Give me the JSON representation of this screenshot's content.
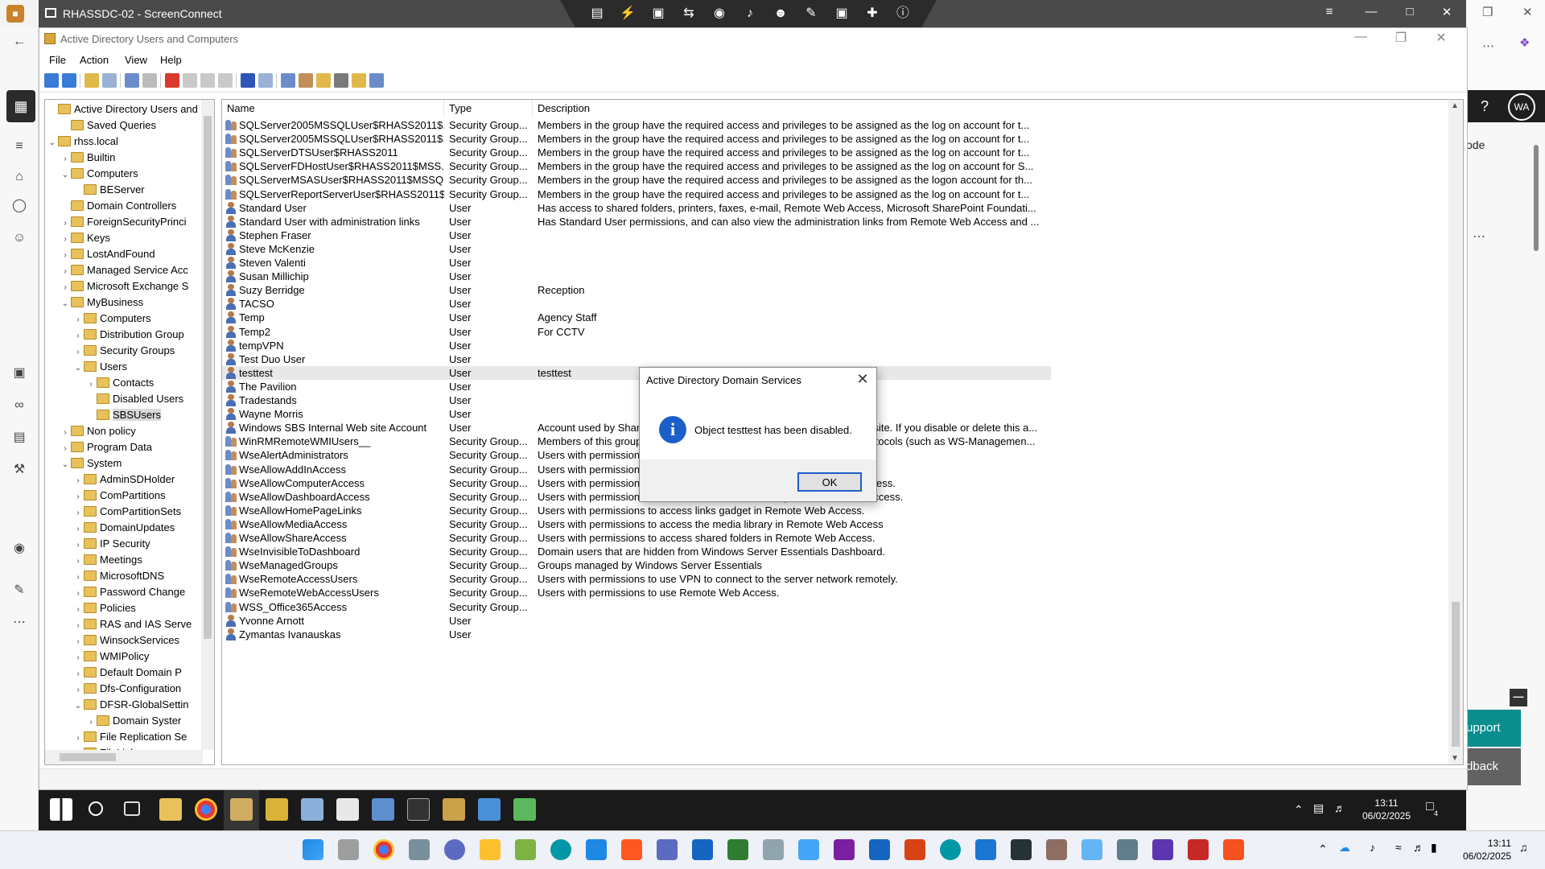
{
  "session": {
    "title": "RHASSDC-02 - ScreenConnect"
  },
  "host_right": {
    "avatar": "WA",
    "partial_text": "ode",
    "support_label": "upport",
    "feedback_label": "dback"
  },
  "aduc": {
    "title": "Active Directory Users and Computers",
    "menu": [
      "File",
      "Action",
      "View",
      "Help"
    ]
  },
  "tree": [
    {
      "label": "Active Directory Users and Co",
      "level": 0,
      "exp": "",
      "sel": false
    },
    {
      "label": "Saved Queries",
      "level": 1,
      "exp": "",
      "sel": false
    },
    {
      "label": "rhss.local",
      "level": 0,
      "exp": "v",
      "sel": false
    },
    {
      "label": "Builtin",
      "level": 1,
      "exp": ">",
      "sel": false
    },
    {
      "label": "Computers",
      "level": 1,
      "exp": "v",
      "sel": false
    },
    {
      "label": "BEServer",
      "level": 2,
      "exp": "",
      "sel": false
    },
    {
      "label": "Domain Controllers",
      "level": 1,
      "exp": "",
      "sel": false
    },
    {
      "label": "ForeignSecurityPrinci",
      "level": 1,
      "exp": ">",
      "sel": false
    },
    {
      "label": "Keys",
      "level": 1,
      "exp": ">",
      "sel": false
    },
    {
      "label": "LostAndFound",
      "level": 1,
      "exp": ">",
      "sel": false
    },
    {
      "label": "Managed Service Acc",
      "level": 1,
      "exp": ">",
      "sel": false
    },
    {
      "label": "Microsoft Exchange S",
      "level": 1,
      "exp": ">",
      "sel": false
    },
    {
      "label": "MyBusiness",
      "level": 1,
      "exp": "v",
      "sel": false
    },
    {
      "label": "Computers",
      "level": 2,
      "exp": ">",
      "sel": false
    },
    {
      "label": "Distribution Group",
      "level": 2,
      "exp": ">",
      "sel": false
    },
    {
      "label": "Security Groups",
      "level": 2,
      "exp": ">",
      "sel": false
    },
    {
      "label": "Users",
      "level": 2,
      "exp": "v",
      "sel": false
    },
    {
      "label": "Contacts",
      "level": 3,
      "exp": ">",
      "sel": false
    },
    {
      "label": "Disabled Users",
      "level": 3,
      "exp": "",
      "sel": false
    },
    {
      "label": "SBSUsers",
      "level": 3,
      "exp": "",
      "sel": true
    },
    {
      "label": "Non policy",
      "level": 1,
      "exp": ">",
      "sel": false
    },
    {
      "label": "Program Data",
      "level": 1,
      "exp": ">",
      "sel": false
    },
    {
      "label": "System",
      "level": 1,
      "exp": "v",
      "sel": false
    },
    {
      "label": "AdminSDHolder",
      "level": 2,
      "exp": ">",
      "sel": false
    },
    {
      "label": "ComPartitions",
      "level": 2,
      "exp": ">",
      "sel": false
    },
    {
      "label": "ComPartitionSets",
      "level": 2,
      "exp": ">",
      "sel": false
    },
    {
      "label": "DomainUpdates",
      "level": 2,
      "exp": ">",
      "sel": false
    },
    {
      "label": "IP Security",
      "level": 2,
      "exp": ">",
      "sel": false
    },
    {
      "label": "Meetings",
      "level": 2,
      "exp": ">",
      "sel": false
    },
    {
      "label": "MicrosoftDNS",
      "level": 2,
      "exp": ">",
      "sel": false
    },
    {
      "label": "Password Change",
      "level": 2,
      "exp": ">",
      "sel": false
    },
    {
      "label": "Policies",
      "level": 2,
      "exp": ">",
      "sel": false
    },
    {
      "label": "RAS and IAS Serve",
      "level": 2,
      "exp": ">",
      "sel": false
    },
    {
      "label": "WinsockServices",
      "level": 2,
      "exp": ">",
      "sel": false
    },
    {
      "label": "WMIPolicy",
      "level": 2,
      "exp": ">",
      "sel": false
    },
    {
      "label": "Default Domain P",
      "level": 2,
      "exp": ">",
      "sel": false
    },
    {
      "label": "Dfs-Configuration",
      "level": 2,
      "exp": ">",
      "sel": false
    },
    {
      "label": "DFSR-GlobalSettin",
      "level": 2,
      "exp": "v",
      "sel": false
    },
    {
      "label": "Domain Syster",
      "level": 3,
      "exp": ">",
      "sel": false
    },
    {
      "label": "File Replication Se",
      "level": 2,
      "exp": ">",
      "sel": false
    },
    {
      "label": "FileLinks",
      "level": 2,
      "exp": ">",
      "sel": false
    }
  ],
  "list": {
    "headers": [
      "Name",
      "Type",
      "Description"
    ],
    "rows": [
      {
        "name": "SQLServer2005MSSQLUser$RHASS2011$...",
        "type": "Security Group...",
        "desc": "Members in the group have the required access and privileges to be assigned as the log on account for t...",
        "kind": "group"
      },
      {
        "name": "SQLServer2005MSSQLUser$RHASS2011$...",
        "type": "Security Group...",
        "desc": "Members in the group have the required access and privileges to be assigned as the log on account for t...",
        "kind": "group"
      },
      {
        "name": "SQLServerDTSUser$RHASS2011",
        "type": "Security Group...",
        "desc": "Members in the group have the required access and privileges to be assigned as the log on account for t...",
        "kind": "group"
      },
      {
        "name": "SQLServerFDHostUser$RHASS2011$MSS...",
        "type": "Security Group...",
        "desc": "Members in the group have the required access and privileges to be assigned as the log on account for S...",
        "kind": "group"
      },
      {
        "name": "SQLServerMSASUser$RHASS2011$MSSQ...",
        "type": "Security Group...",
        "desc": "Members in the group have the required access and privileges to be assigned as the logon account for th...",
        "kind": "group"
      },
      {
        "name": "SQLServerReportServerUser$RHASS2011$...",
        "type": "Security Group...",
        "desc": "Members in the group have the required access and privileges to be assigned as the log on account for t...",
        "kind": "group"
      },
      {
        "name": "Standard User",
        "type": "User",
        "desc": "Has access to shared folders, printers, faxes, e-mail, Remote Web Access, Microsoft SharePoint Foundati...",
        "kind": "user"
      },
      {
        "name": "Standard User with administration links",
        "type": "User",
        "desc": "Has Standard User permissions, and can also view the administration links from Remote Web Access and ...",
        "kind": "user"
      },
      {
        "name": "Stephen Fraser",
        "type": "User",
        "desc": "",
        "kind": "user"
      },
      {
        "name": "Steve McKenzie",
        "type": "User",
        "desc": "",
        "kind": "user"
      },
      {
        "name": "Steven Valenti",
        "type": "User",
        "desc": "",
        "kind": "user"
      },
      {
        "name": "Susan Millichip",
        "type": "User",
        "desc": "",
        "kind": "user"
      },
      {
        "name": "Suzy Berridge",
        "type": "User",
        "desc": "Reception",
        "kind": "user"
      },
      {
        "name": "TACSO",
        "type": "User",
        "desc": "",
        "kind": "user"
      },
      {
        "name": "Temp",
        "type": "User",
        "desc": "Agency Staff",
        "kind": "user"
      },
      {
        "name": "Temp2",
        "type": "User",
        "desc": "For CCTV",
        "kind": "user"
      },
      {
        "name": "tempVPN",
        "type": "User",
        "desc": "",
        "kind": "user"
      },
      {
        "name": "Test Duo User",
        "type": "User",
        "desc": "",
        "kind": "user"
      },
      {
        "name": "testtest",
        "type": "User",
        "desc": "testtest",
        "kind": "user",
        "hl": true
      },
      {
        "name": "The Pavilion",
        "type": "User",
        "desc": "",
        "kind": "user"
      },
      {
        "name": "Tradestands",
        "type": "User",
        "desc": "",
        "kind": "user"
      },
      {
        "name": "Wayne Morris",
        "type": "User",
        "desc": "",
        "kind": "user"
      },
      {
        "name": "Windows SBS Internal Web site Account",
        "type": "User",
        "desc": "Account used by SharePoint to manage the Windows SBS Internal Web site. If you disable or delete this a...",
        "kind": "user"
      },
      {
        "name": "WinRMRemoteWMIUsers__",
        "type": "Security Group...",
        "desc": "Members of this group can access WMI resources over management protocols (such as WS-Managemen...",
        "kind": "group"
      },
      {
        "name": "WseAlertAdministrators",
        "type": "Security Group...",
        "desc": "Users with permissions to view alerts in the network.",
        "kind": "group"
      },
      {
        "name": "WseAllowAddInAccess",
        "type": "Security Group...",
        "desc": "Users with permissions to access Windows Server Essentials Add-ins.",
        "kind": "group"
      },
      {
        "name": "WseAllowComputerAccess",
        "type": "Security Group...",
        "desc": "Users with permissions to access computer remotely in Remote Web Access.",
        "kind": "group"
      },
      {
        "name": "WseAllowDashboardAccess",
        "type": "Security Group...",
        "desc": "Users with permissions to access Dashboard remotely in Remote Web Access.",
        "kind": "group"
      },
      {
        "name": "WseAllowHomePageLinks",
        "type": "Security Group...",
        "desc": "Users with permissions to access links gadget in Remote Web Access.",
        "kind": "group"
      },
      {
        "name": "WseAllowMediaAccess",
        "type": "Security Group...",
        "desc": "Users with permissions to access the media library in Remote Web Access",
        "kind": "group"
      },
      {
        "name": "WseAllowShareAccess",
        "type": "Security Group...",
        "desc": "Users with permissions to access shared folders in Remote Web Access.",
        "kind": "group"
      },
      {
        "name": "WseInvisibleToDashboard",
        "type": "Security Group...",
        "desc": "Domain users that are hidden from Windows Server Essentials Dashboard.",
        "kind": "group"
      },
      {
        "name": "WseManagedGroups",
        "type": "Security Group...",
        "desc": "Groups managed by Windows Server Essentials",
        "kind": "group"
      },
      {
        "name": "WseRemoteAccessUsers",
        "type": "Security Group...",
        "desc": "Users with permissions to use VPN to connect to the server network remotely.",
        "kind": "group"
      },
      {
        "name": "WseRemoteWebAccessUsers",
        "type": "Security Group...",
        "desc": "Users with permissions to use Remote Web Access.",
        "kind": "group"
      },
      {
        "name": "WSS_Office365Access",
        "type": "Security Group...",
        "desc": "",
        "kind": "group"
      },
      {
        "name": "Yvonne Arnott",
        "type": "User",
        "desc": "",
        "kind": "user"
      },
      {
        "name": "Zymantas Ivanauskas",
        "type": "User",
        "desc": "",
        "kind": "user"
      }
    ]
  },
  "dialog": {
    "title": "Active Directory Domain Services",
    "message": "Object testtest has been disabled.",
    "ok_label": "OK"
  },
  "remote_taskbar": {
    "time": "13:11",
    "date": "06/02/2025",
    "notification_count": "4"
  },
  "host_taskbar": {
    "time": "13:11",
    "date": "06/02/2025"
  }
}
